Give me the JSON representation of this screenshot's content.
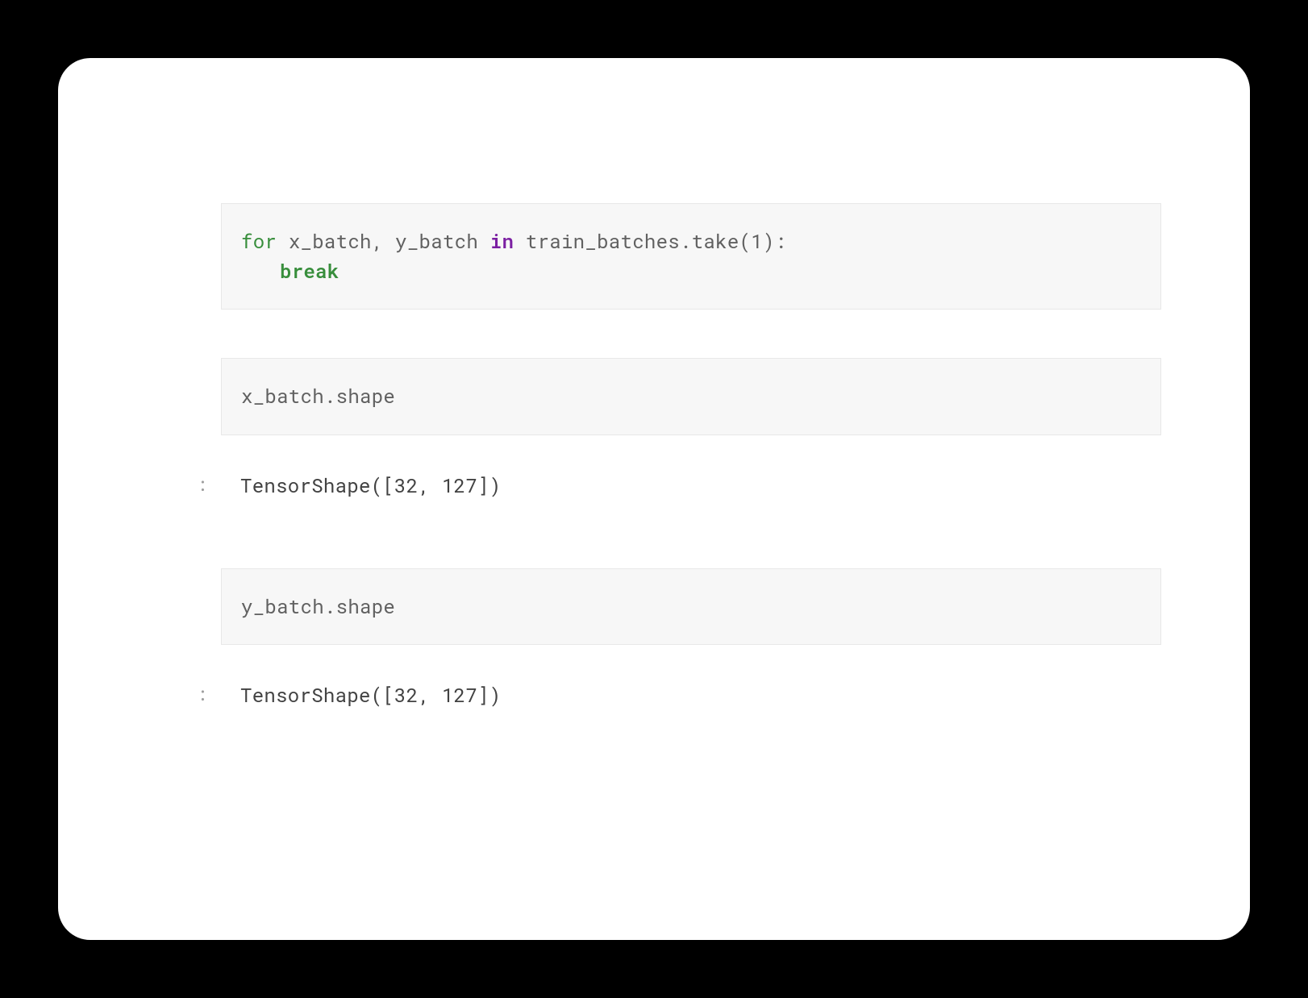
{
  "cells": {
    "c1": {
      "line1": {
        "for": "for",
        "sp1": " ",
        "x_batch": "x_batch",
        "comma": ",",
        "sp2": " ",
        "y_batch": "y_batch",
        "sp3": " ",
        "in": "in",
        "sp4": " ",
        "train_batches": "train_batches",
        "dot": ".",
        "take": "take",
        "paren_open": "(",
        "one": "1",
        "paren_close": ")",
        "colon": ":"
      },
      "line2": {
        "break": "break"
      }
    },
    "c2": {
      "input": {
        "x_batch": "x_batch",
        "dot": ".",
        "shape": "shape"
      },
      "out_marker": ":",
      "output": "TensorShape([32, 127])"
    },
    "c3": {
      "input": {
        "y_batch": "y_batch",
        "dot": ".",
        "shape": "shape"
      },
      "out_marker": ":",
      "output": "TensorShape([32, 127])"
    }
  }
}
